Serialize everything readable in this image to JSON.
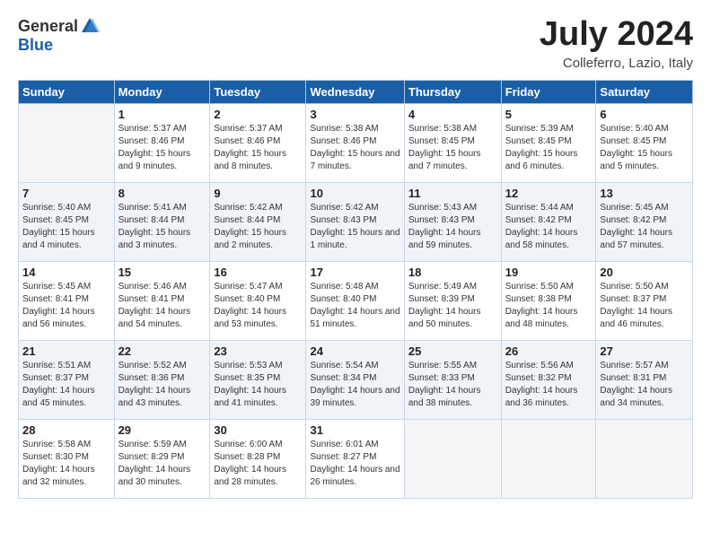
{
  "header": {
    "logo": {
      "general": "General",
      "blue": "Blue"
    },
    "title": "July 2024",
    "location": "Colleferro, Lazio, Italy"
  },
  "days_of_week": [
    "Sunday",
    "Monday",
    "Tuesday",
    "Wednesday",
    "Thursday",
    "Friday",
    "Saturday"
  ],
  "weeks": [
    [
      {
        "day": "",
        "sunrise": "",
        "sunset": "",
        "daylight": ""
      },
      {
        "day": "1",
        "sunrise": "Sunrise: 5:37 AM",
        "sunset": "Sunset: 8:46 PM",
        "daylight": "Daylight: 15 hours and 9 minutes."
      },
      {
        "day": "2",
        "sunrise": "Sunrise: 5:37 AM",
        "sunset": "Sunset: 8:46 PM",
        "daylight": "Daylight: 15 hours and 8 minutes."
      },
      {
        "day": "3",
        "sunrise": "Sunrise: 5:38 AM",
        "sunset": "Sunset: 8:46 PM",
        "daylight": "Daylight: 15 hours and 7 minutes."
      },
      {
        "day": "4",
        "sunrise": "Sunrise: 5:38 AM",
        "sunset": "Sunset: 8:45 PM",
        "daylight": "Daylight: 15 hours and 7 minutes."
      },
      {
        "day": "5",
        "sunrise": "Sunrise: 5:39 AM",
        "sunset": "Sunset: 8:45 PM",
        "daylight": "Daylight: 15 hours and 6 minutes."
      },
      {
        "day": "6",
        "sunrise": "Sunrise: 5:40 AM",
        "sunset": "Sunset: 8:45 PM",
        "daylight": "Daylight: 15 hours and 5 minutes."
      }
    ],
    [
      {
        "day": "7",
        "sunrise": "Sunrise: 5:40 AM",
        "sunset": "Sunset: 8:45 PM",
        "daylight": "Daylight: 15 hours and 4 minutes."
      },
      {
        "day": "8",
        "sunrise": "Sunrise: 5:41 AM",
        "sunset": "Sunset: 8:44 PM",
        "daylight": "Daylight: 15 hours and 3 minutes."
      },
      {
        "day": "9",
        "sunrise": "Sunrise: 5:42 AM",
        "sunset": "Sunset: 8:44 PM",
        "daylight": "Daylight: 15 hours and 2 minutes."
      },
      {
        "day": "10",
        "sunrise": "Sunrise: 5:42 AM",
        "sunset": "Sunset: 8:43 PM",
        "daylight": "Daylight: 15 hours and 1 minute."
      },
      {
        "day": "11",
        "sunrise": "Sunrise: 5:43 AM",
        "sunset": "Sunset: 8:43 PM",
        "daylight": "Daylight: 14 hours and 59 minutes."
      },
      {
        "day": "12",
        "sunrise": "Sunrise: 5:44 AM",
        "sunset": "Sunset: 8:42 PM",
        "daylight": "Daylight: 14 hours and 58 minutes."
      },
      {
        "day": "13",
        "sunrise": "Sunrise: 5:45 AM",
        "sunset": "Sunset: 8:42 PM",
        "daylight": "Daylight: 14 hours and 57 minutes."
      }
    ],
    [
      {
        "day": "14",
        "sunrise": "Sunrise: 5:45 AM",
        "sunset": "Sunset: 8:41 PM",
        "daylight": "Daylight: 14 hours and 56 minutes."
      },
      {
        "day": "15",
        "sunrise": "Sunrise: 5:46 AM",
        "sunset": "Sunset: 8:41 PM",
        "daylight": "Daylight: 14 hours and 54 minutes."
      },
      {
        "day": "16",
        "sunrise": "Sunrise: 5:47 AM",
        "sunset": "Sunset: 8:40 PM",
        "daylight": "Daylight: 14 hours and 53 minutes."
      },
      {
        "day": "17",
        "sunrise": "Sunrise: 5:48 AM",
        "sunset": "Sunset: 8:40 PM",
        "daylight": "Daylight: 14 hours and 51 minutes."
      },
      {
        "day": "18",
        "sunrise": "Sunrise: 5:49 AM",
        "sunset": "Sunset: 8:39 PM",
        "daylight": "Daylight: 14 hours and 50 minutes."
      },
      {
        "day": "19",
        "sunrise": "Sunrise: 5:50 AM",
        "sunset": "Sunset: 8:38 PM",
        "daylight": "Daylight: 14 hours and 48 minutes."
      },
      {
        "day": "20",
        "sunrise": "Sunrise: 5:50 AM",
        "sunset": "Sunset: 8:37 PM",
        "daylight": "Daylight: 14 hours and 46 minutes."
      }
    ],
    [
      {
        "day": "21",
        "sunrise": "Sunrise: 5:51 AM",
        "sunset": "Sunset: 8:37 PM",
        "daylight": "Daylight: 14 hours and 45 minutes."
      },
      {
        "day": "22",
        "sunrise": "Sunrise: 5:52 AM",
        "sunset": "Sunset: 8:36 PM",
        "daylight": "Daylight: 14 hours and 43 minutes."
      },
      {
        "day": "23",
        "sunrise": "Sunrise: 5:53 AM",
        "sunset": "Sunset: 8:35 PM",
        "daylight": "Daylight: 14 hours and 41 minutes."
      },
      {
        "day": "24",
        "sunrise": "Sunrise: 5:54 AM",
        "sunset": "Sunset: 8:34 PM",
        "daylight": "Daylight: 14 hours and 39 minutes."
      },
      {
        "day": "25",
        "sunrise": "Sunrise: 5:55 AM",
        "sunset": "Sunset: 8:33 PM",
        "daylight": "Daylight: 14 hours and 38 minutes."
      },
      {
        "day": "26",
        "sunrise": "Sunrise: 5:56 AM",
        "sunset": "Sunset: 8:32 PM",
        "daylight": "Daylight: 14 hours and 36 minutes."
      },
      {
        "day": "27",
        "sunrise": "Sunrise: 5:57 AM",
        "sunset": "Sunset: 8:31 PM",
        "daylight": "Daylight: 14 hours and 34 minutes."
      }
    ],
    [
      {
        "day": "28",
        "sunrise": "Sunrise: 5:58 AM",
        "sunset": "Sunset: 8:30 PM",
        "daylight": "Daylight: 14 hours and 32 minutes."
      },
      {
        "day": "29",
        "sunrise": "Sunrise: 5:59 AM",
        "sunset": "Sunset: 8:29 PM",
        "daylight": "Daylight: 14 hours and 30 minutes."
      },
      {
        "day": "30",
        "sunrise": "Sunrise: 6:00 AM",
        "sunset": "Sunset: 8:28 PM",
        "daylight": "Daylight: 14 hours and 28 minutes."
      },
      {
        "day": "31",
        "sunrise": "Sunrise: 6:01 AM",
        "sunset": "Sunset: 8:27 PM",
        "daylight": "Daylight: 14 hours and 26 minutes."
      },
      {
        "day": "",
        "sunrise": "",
        "sunset": "",
        "daylight": ""
      },
      {
        "day": "",
        "sunrise": "",
        "sunset": "",
        "daylight": ""
      },
      {
        "day": "",
        "sunrise": "",
        "sunset": "",
        "daylight": ""
      }
    ]
  ]
}
